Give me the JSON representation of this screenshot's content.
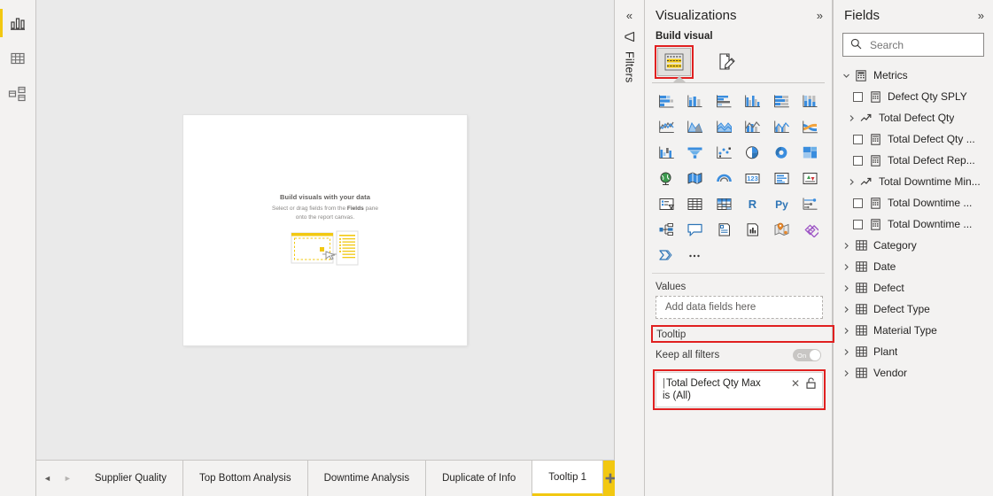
{
  "colors": {
    "accent_yellow": "#f2c811",
    "highlight_red": "#e02020",
    "panel_bg": "#f3f2f1",
    "canvas_bg": "#eaeaea",
    "blue_icon": "#2e75b6",
    "text": "#252423"
  },
  "left_rail": {
    "items": [
      {
        "name": "report-view",
        "icon": "bar-chart-icon",
        "active": true
      },
      {
        "name": "data-view",
        "icon": "table-icon",
        "active": false
      },
      {
        "name": "model-view",
        "icon": "model-relationship-icon",
        "active": false
      }
    ]
  },
  "canvas": {
    "placeholder_title": "Build visuals with your data",
    "placeholder_sub_1": "Select or drag fields from the ",
    "placeholder_sub_bold": "Fields",
    "placeholder_sub_2": " pane",
    "placeholder_sub_3": "onto the report canvas."
  },
  "page_tabs": {
    "prev_label": "◄",
    "next_label": "►",
    "tabs": [
      {
        "label": "Supplier Quality",
        "active": false
      },
      {
        "label": "Top Bottom Analysis",
        "active": false
      },
      {
        "label": "Downtime Analysis",
        "active": false
      },
      {
        "label": "Duplicate of Info",
        "active": false
      },
      {
        "label": "Tooltip 1",
        "active": true
      }
    ],
    "add_page_name": "add-page-button"
  },
  "filters_rail": {
    "collapse_label": "«",
    "title": "Filters"
  },
  "visualizations": {
    "title": "Visualizations",
    "expand_label": "»",
    "build_visual_label": "Build visual",
    "tabs": [
      {
        "name": "build-visual-tab",
        "icon": "fields-build-icon",
        "selected": true,
        "highlighted": true
      },
      {
        "name": "format-visual-tab",
        "icon": "format-paintbrush-icon",
        "selected": false,
        "highlighted": false
      }
    ],
    "visual_icons": [
      "stacked-bar-chart-icon",
      "stacked-column-chart-icon",
      "clustered-bar-chart-icon",
      "clustered-column-chart-icon",
      "100-stacked-bar-chart-icon",
      "100-stacked-column-chart-icon",
      "line-chart-icon",
      "area-chart-icon",
      "stacked-area-chart-icon",
      "line-stacked-column-chart-icon",
      "line-clustered-column-chart-icon",
      "ribbon-chart-icon",
      "waterfall-chart-icon",
      "funnel-chart-icon",
      "scatter-chart-icon",
      "pie-chart-icon",
      "donut-chart-icon",
      "treemap-icon",
      "map-icon",
      "filled-map-icon",
      "azure-map-icon",
      "card-icon",
      "multi-row-card-icon",
      "kpi-icon",
      "slicer-icon",
      "table-icon",
      "matrix-icon",
      "r-script-visual-icon",
      "python-visual-icon",
      "key-influencers-icon",
      "decomposition-tree-icon",
      "qa-visual-icon",
      "smart-narrative-icon",
      "paginated-report-icon",
      "arcgis-map-icon",
      "power-apps-icon",
      "power-automate-icon",
      "more-options-icon"
    ],
    "values_label": "Values",
    "values_dropzone_placeholder": "Add data fields here",
    "tooltip_label": "Tooltip",
    "keep_all_filters_label": "Keep all filters",
    "keep_all_filters_toggle": "On",
    "filter_card": {
      "field_name": "Total Defect Qty Max",
      "remove_label": "✕",
      "lock_icon": "unlocked-padlock-icon",
      "condition": "is (All)"
    }
  },
  "fields": {
    "title": "Fields",
    "expand_label": "»",
    "search_placeholder": "Search",
    "search_value": "",
    "tree": [
      {
        "label": "Metrics",
        "type": "table-group",
        "indent": 0,
        "expanded": true,
        "icon": "metrics-table-icon",
        "has_checkbox": false
      },
      {
        "label": "Defect Qty SPLY",
        "type": "measure",
        "indent": 1,
        "icon": "measure-calculator-icon",
        "has_checkbox": true,
        "checked": false
      },
      {
        "label": "Total Defect Qty",
        "type": "folder",
        "indent": 1,
        "expanded": false,
        "icon": "measure-trend-icon",
        "has_checkbox": false
      },
      {
        "label": "Total Defect Qty ...",
        "type": "measure",
        "indent": 1,
        "icon": "measure-calculator-icon",
        "has_checkbox": true,
        "checked": false
      },
      {
        "label": "Total Defect Rep...",
        "type": "measure",
        "indent": 1,
        "icon": "measure-calculator-icon",
        "has_checkbox": true,
        "checked": false
      },
      {
        "label": "Total Downtime Min...",
        "type": "folder",
        "indent": 1,
        "expanded": false,
        "icon": "measure-trend-icon",
        "has_checkbox": false
      },
      {
        "label": "Total Downtime ...",
        "type": "measure",
        "indent": 1,
        "icon": "measure-calculator-icon",
        "has_checkbox": true,
        "checked": false
      },
      {
        "label": "Total Downtime ...",
        "type": "measure",
        "indent": 1,
        "icon": "measure-calculator-icon",
        "has_checkbox": true,
        "checked": false
      },
      {
        "label": "Category",
        "type": "table",
        "indent": 0,
        "expanded": false,
        "icon": "table-grid-icon",
        "has_checkbox": false
      },
      {
        "label": "Date",
        "type": "table",
        "indent": 0,
        "expanded": false,
        "icon": "table-grid-icon",
        "has_checkbox": false
      },
      {
        "label": "Defect",
        "type": "table",
        "indent": 0,
        "expanded": false,
        "icon": "table-grid-icon",
        "has_checkbox": false
      },
      {
        "label": "Defect Type",
        "type": "table",
        "indent": 0,
        "expanded": false,
        "icon": "table-grid-icon",
        "has_checkbox": false
      },
      {
        "label": "Material Type",
        "type": "table",
        "indent": 0,
        "expanded": false,
        "icon": "table-grid-icon",
        "has_checkbox": false
      },
      {
        "label": "Plant",
        "type": "table",
        "indent": 0,
        "expanded": false,
        "icon": "table-grid-icon",
        "has_checkbox": false
      },
      {
        "label": "Vendor",
        "type": "table",
        "indent": 0,
        "expanded": false,
        "icon": "table-grid-icon",
        "has_checkbox": false
      }
    ]
  }
}
